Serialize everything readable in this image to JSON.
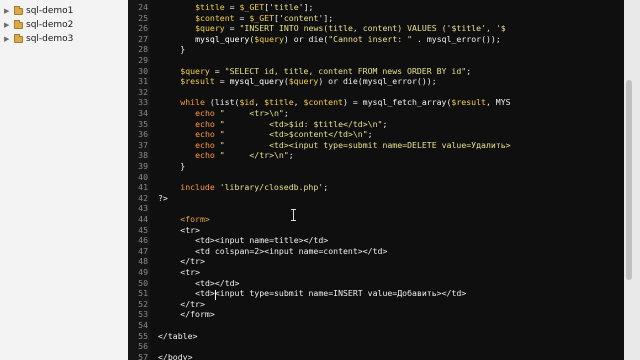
{
  "sidebar": {
    "items": [
      {
        "label": "sql-demo1"
      },
      {
        "label": "sql-demo2"
      },
      {
        "label": "sql-demo3"
      }
    ]
  },
  "editor": {
    "lines": [
      {
        "n": "24",
        "segs": [
          {
            "t": "$title",
            "c": "var"
          },
          {
            "t": " = ",
            "c": "plain"
          },
          {
            "t": "$_GET",
            "c": "var"
          },
          {
            "t": "['",
            "c": "plain"
          },
          {
            "t": "title",
            "c": "string"
          },
          {
            "t": "'];",
            "c": "plain"
          }
        ]
      },
      {
        "n": "25",
        "segs": [
          {
            "t": "$content",
            "c": "var"
          },
          {
            "t": " = ",
            "c": "plain"
          },
          {
            "t": "$_GET",
            "c": "var"
          },
          {
            "t": "['",
            "c": "plain"
          },
          {
            "t": "content",
            "c": "string"
          },
          {
            "t": "'];",
            "c": "plain"
          }
        ]
      },
      {
        "n": "26",
        "segs": [
          {
            "t": "$query",
            "c": "var"
          },
          {
            "t": " = ",
            "c": "plain"
          },
          {
            "t": "\"INSERT INTO news(title, content) VALUES ('$title', '$",
            "c": "string"
          }
        ]
      },
      {
        "n": "27",
        "segs": [
          {
            "t": "mysql_query",
            "c": "func"
          },
          {
            "t": "(",
            "c": "plain"
          },
          {
            "t": "$query",
            "c": "var"
          },
          {
            "t": ") or die(",
            "c": "plain"
          },
          {
            "t": "\"Cannot insert: \"",
            "c": "string"
          },
          {
            "t": " . mysql_error());",
            "c": "plain"
          }
        ]
      },
      {
        "n": "28",
        "segs": [
          {
            "t": "}",
            "c": "plain"
          }
        ]
      },
      {
        "n": "29",
        "segs": []
      },
      {
        "n": "30",
        "segs": [
          {
            "t": "$query",
            "c": "var"
          },
          {
            "t": " = ",
            "c": "plain"
          },
          {
            "t": "\"SELECT id, title, content FROM news ORDER BY id\"",
            "c": "string"
          },
          {
            "t": ";",
            "c": "plain"
          }
        ]
      },
      {
        "n": "31",
        "segs": [
          {
            "t": "$result",
            "c": "var"
          },
          {
            "t": " = ",
            "c": "plain"
          },
          {
            "t": "mysql_query",
            "c": "func"
          },
          {
            "t": "(",
            "c": "plain"
          },
          {
            "t": "$query",
            "c": "var"
          },
          {
            "t": ") or die(mysql_error());",
            "c": "plain"
          }
        ]
      },
      {
        "n": "32",
        "segs": []
      },
      {
        "n": "33",
        "segs": [
          {
            "t": "while",
            "c": "keyword"
          },
          {
            "t": " (list(",
            "c": "plain"
          },
          {
            "t": "$id",
            "c": "var"
          },
          {
            "t": ", ",
            "c": "plain"
          },
          {
            "t": "$title",
            "c": "var"
          },
          {
            "t": ", ",
            "c": "plain"
          },
          {
            "t": "$content",
            "c": "var"
          },
          {
            "t": ") = mysql_fetch_array(",
            "c": "plain"
          },
          {
            "t": "$result",
            "c": "var"
          },
          {
            "t": ", MYS",
            "c": "plain"
          }
        ]
      },
      {
        "n": "34",
        "segs": [
          {
            "t": "echo ",
            "c": "keyword"
          },
          {
            "t": "\"     <tr>\\n\"",
            "c": "string"
          },
          {
            "t": ";",
            "c": "plain"
          }
        ]
      },
      {
        "n": "35",
        "segs": [
          {
            "t": "echo ",
            "c": "keyword"
          },
          {
            "t": "\"         <td>$id: $title</td>\\n\"",
            "c": "string"
          },
          {
            "t": ";",
            "c": "plain"
          }
        ]
      },
      {
        "n": "36",
        "segs": [
          {
            "t": "echo ",
            "c": "keyword"
          },
          {
            "t": "\"         <td>$content</td>\\n\"",
            "c": "string"
          },
          {
            "t": ";",
            "c": "plain"
          }
        ]
      },
      {
        "n": "37",
        "segs": [
          {
            "t": "echo ",
            "c": "keyword"
          },
          {
            "t": "\"         <td><input type=submit name=DELETE value=Удалить>",
            "c": "string"
          }
        ]
      },
      {
        "n": "38",
        "segs": [
          {
            "t": "echo ",
            "c": "keyword"
          },
          {
            "t": "\"     </tr>\\n\"",
            "c": "string"
          },
          {
            "t": ";",
            "c": "plain"
          }
        ]
      },
      {
        "n": "39",
        "segs": [
          {
            "t": "}",
            "c": "plain"
          }
        ]
      },
      {
        "n": "40",
        "segs": []
      },
      {
        "n": "41",
        "segs": [
          {
            "t": "include ",
            "c": "keyword"
          },
          {
            "t": "'library/closedb.php'",
            "c": "string"
          },
          {
            "t": ";",
            "c": "plain"
          }
        ]
      },
      {
        "n": "42",
        "segs": [
          {
            "t": "?>",
            "c": "plain"
          }
        ]
      },
      {
        "n": "43",
        "segs": []
      },
      {
        "n": "44",
        "segs": [
          {
            "t": "<form>",
            "c": "tag"
          }
        ]
      },
      {
        "n": "45",
        "segs": [
          {
            "t": "<tr>",
            "c": "plain"
          }
        ]
      },
      {
        "n": "46",
        "segs": [
          {
            "t": "<td><input name=title></td>",
            "c": "plain"
          }
        ]
      },
      {
        "n": "47",
        "segs": [
          {
            "t": "<td colspan=2><input name=content></td>",
            "c": "plain"
          }
        ]
      },
      {
        "n": "48",
        "segs": [
          {
            "t": "</tr>",
            "c": "plain"
          }
        ]
      },
      {
        "n": "49",
        "segs": [
          {
            "t": "<tr>",
            "c": "plain"
          }
        ]
      },
      {
        "n": "50",
        "segs": [
          {
            "t": "<td></td>",
            "c": "plain"
          }
        ]
      },
      {
        "n": "51",
        "segs": [
          {
            "t": "<td><input type=submit name=INSERT value=Добавить></td>",
            "c": "plain"
          }
        ]
      },
      {
        "n": "52",
        "segs": [
          {
            "t": "</tr>",
            "c": "plain"
          }
        ]
      },
      {
        "n": "53",
        "segs": [
          {
            "t": "</form>",
            "c": "plain"
          }
        ]
      },
      {
        "n": "54",
        "segs": []
      },
      {
        "n": "55",
        "segs": [
          {
            "t": "</table>",
            "c": "plain"
          }
        ]
      },
      {
        "n": "56",
        "segs": []
      },
      {
        "n": "57",
        "segs": [
          {
            "t": "</body>",
            "c": "plain"
          }
        ]
      }
    ]
  },
  "colors": {
    "editor_bg": "#0f0f0f",
    "keyword": "#ff9a3c",
    "variable": "#f3d048",
    "string": "#e9e08a",
    "tag": "#e6a34a",
    "plain": "#f1f1f1",
    "line_number": "#8a8a8a"
  },
  "icons": {
    "tree_expand": "chevron-right-icon",
    "tree_folder": "folder-icon",
    "mouse_cursor": "text-cursor-icon"
  }
}
